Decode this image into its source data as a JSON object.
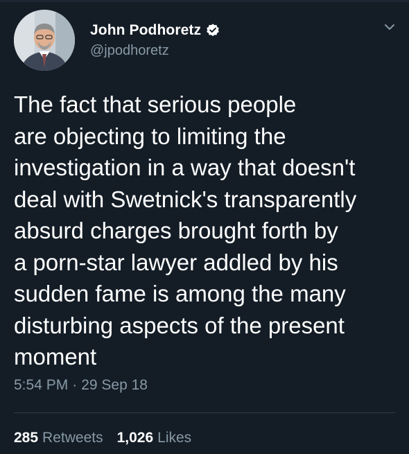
{
  "user": {
    "name": "John Podhoretz",
    "handle": "@jpodhoretz",
    "verified": true
  },
  "tweet": {
    "lines": [
      "The fact that serious people",
      "are objecting to limiting the",
      "investigation in a way that doesn't",
      "deal with Swetnick's transparently",
      "absurd charges brought forth by",
      "a porn-star lawyer addled by his",
      "sudden fame is among the many",
      "disturbing aspects of the present",
      "moment"
    ],
    "time": "5:54 PM",
    "separator": "·",
    "date": "29 Sep 18"
  },
  "stats": {
    "retweets_count": "285",
    "retweets_label": "Retweets",
    "likes_count": "1,026",
    "likes_label": "Likes"
  },
  "icons": {
    "verified": "verified-badge-icon",
    "menu": "chevron-down-icon"
  },
  "colors": {
    "background": "#141d26",
    "text": "#ffffff",
    "secondary": "#8899a6",
    "divider": "#2b3a48"
  }
}
